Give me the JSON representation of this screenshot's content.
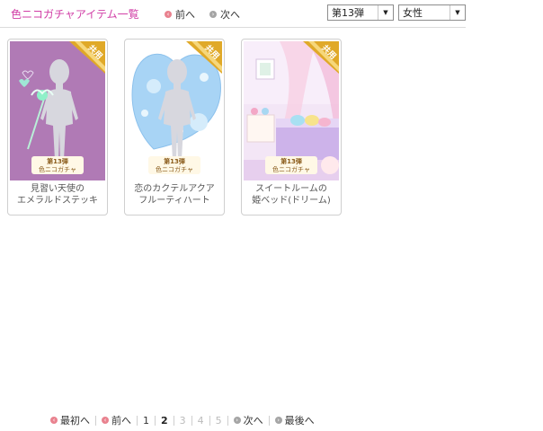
{
  "header": {
    "title": "色ニコガチャアイテム一覧",
    "prev_label": "前へ",
    "next_label": "次へ",
    "series_select": "第13弾",
    "gender_select": "女性"
  },
  "items": [
    {
      "badge": "共用",
      "tag_line1": "第13弾",
      "tag_line2": "色ニコガチャ",
      "caption_line1": "見習い天使の",
      "caption_line2": "エメラルドステッキ",
      "bg": "#b07ab5"
    },
    {
      "badge": "共用",
      "tag_line1": "第13弾",
      "tag_line2": "色ニコガチャ",
      "caption_line1": "恋のカクテルアクア",
      "caption_line2": "フルーティハート",
      "bg": "#ffffff"
    },
    {
      "badge": "共用",
      "tag_line1": "第13弾",
      "tag_line2": "色ニコガチャ",
      "caption_line1": "スイートルームの",
      "caption_line2": "姫ベッド(ドリーム)",
      "bg": "#f3e6f6"
    }
  ],
  "pagination": {
    "first": "最初へ",
    "prev": "前へ",
    "pages": [
      "1",
      "2",
      "3",
      "4",
      "5"
    ],
    "current": "2",
    "next": "次へ",
    "last": "最後へ"
  },
  "colors": {
    "title": "#d13ea6",
    "badge": "#e0a928",
    "card_border": "#cfcfcf"
  }
}
